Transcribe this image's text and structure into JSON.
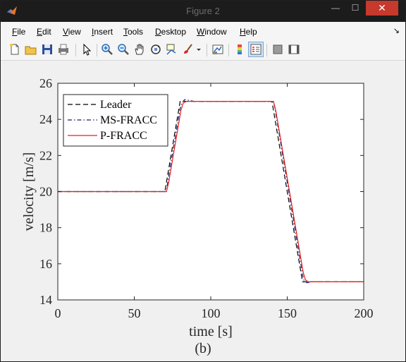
{
  "window": {
    "title": "Figure 2",
    "minimize_glyph": "—",
    "maximize_glyph": "☐",
    "close_glyph": "✕"
  },
  "menu": {
    "items": [
      {
        "key": "F",
        "rest": "ile",
        "label": "File"
      },
      {
        "key": "E",
        "rest": "dit",
        "label": "Edit"
      },
      {
        "key": "V",
        "rest": "iew",
        "label": "View"
      },
      {
        "key": "I",
        "rest": "nsert",
        "label": "Insert"
      },
      {
        "key": "T",
        "rest": "ools",
        "label": "Tools"
      },
      {
        "key": "D",
        "rest": "esktop",
        "label": "Desktop"
      },
      {
        "key": "W",
        "rest": "indow",
        "label": "Window"
      },
      {
        "key": "H",
        "rest": "elp",
        "label": "Help"
      }
    ],
    "dock_arrow": "↘"
  },
  "toolbar": {
    "icons": [
      "new-figure-icon",
      "open-file-icon",
      "save-icon",
      "print-icon",
      "pointer-icon",
      "zoom-in-icon",
      "zoom-out-icon",
      "pan-icon",
      "rotate-3d-icon",
      "data-cursor-icon",
      "brush-icon",
      "link-icon",
      "colorbar-icon",
      "legend-icon",
      "hide-plot-tools-icon",
      "show-plot-tools-icon"
    ]
  },
  "chart_data": {
    "type": "line",
    "title": "",
    "xlabel": "time [s]",
    "ylabel": "velocity [m/s]",
    "xlim": [
      0,
      200
    ],
    "ylim": [
      14,
      26
    ],
    "xticks": [
      0,
      50,
      100,
      150,
      200
    ],
    "yticks": [
      14,
      16,
      18,
      20,
      22,
      24,
      26
    ],
    "grid": false,
    "legend_position": "top-left",
    "series": [
      {
        "name": "Leader",
        "color": "#000000",
        "style": "dashed",
        "points": [
          [
            0,
            20
          ],
          [
            70,
            20
          ],
          [
            80,
            25
          ],
          [
            140,
            25
          ],
          [
            160,
            15
          ],
          [
            200,
            15
          ]
        ]
      },
      {
        "name": "MS-FRACC",
        "color": "#1f1f7a",
        "style": "dashdot",
        "points": [
          [
            0,
            20
          ],
          [
            71,
            20
          ],
          [
            72,
            20.6
          ],
          [
            80,
            24.6
          ],
          [
            81,
            24.9
          ],
          [
            83,
            25.1
          ],
          [
            86,
            25.05
          ],
          [
            89,
            25
          ],
          [
            141,
            25
          ],
          [
            142,
            24.6
          ],
          [
            160,
            15.4
          ],
          [
            161,
            15.05
          ],
          [
            163,
            14.95
          ],
          [
            166,
            15
          ],
          [
            200,
            15
          ]
        ]
      },
      {
        "name": "P-FRACC",
        "color": "#e3211c",
        "style": "solid",
        "points": [
          [
            0,
            20
          ],
          [
            71,
            20
          ],
          [
            72.5,
            20.5
          ],
          [
            80.5,
            24.5
          ],
          [
            82,
            24.9
          ],
          [
            84,
            25
          ],
          [
            141,
            25
          ],
          [
            142.5,
            24.5
          ],
          [
            160.5,
            15.5
          ],
          [
            162,
            15.1
          ],
          [
            164,
            15
          ],
          [
            200,
            15
          ]
        ]
      }
    ]
  },
  "caption": "(b)"
}
